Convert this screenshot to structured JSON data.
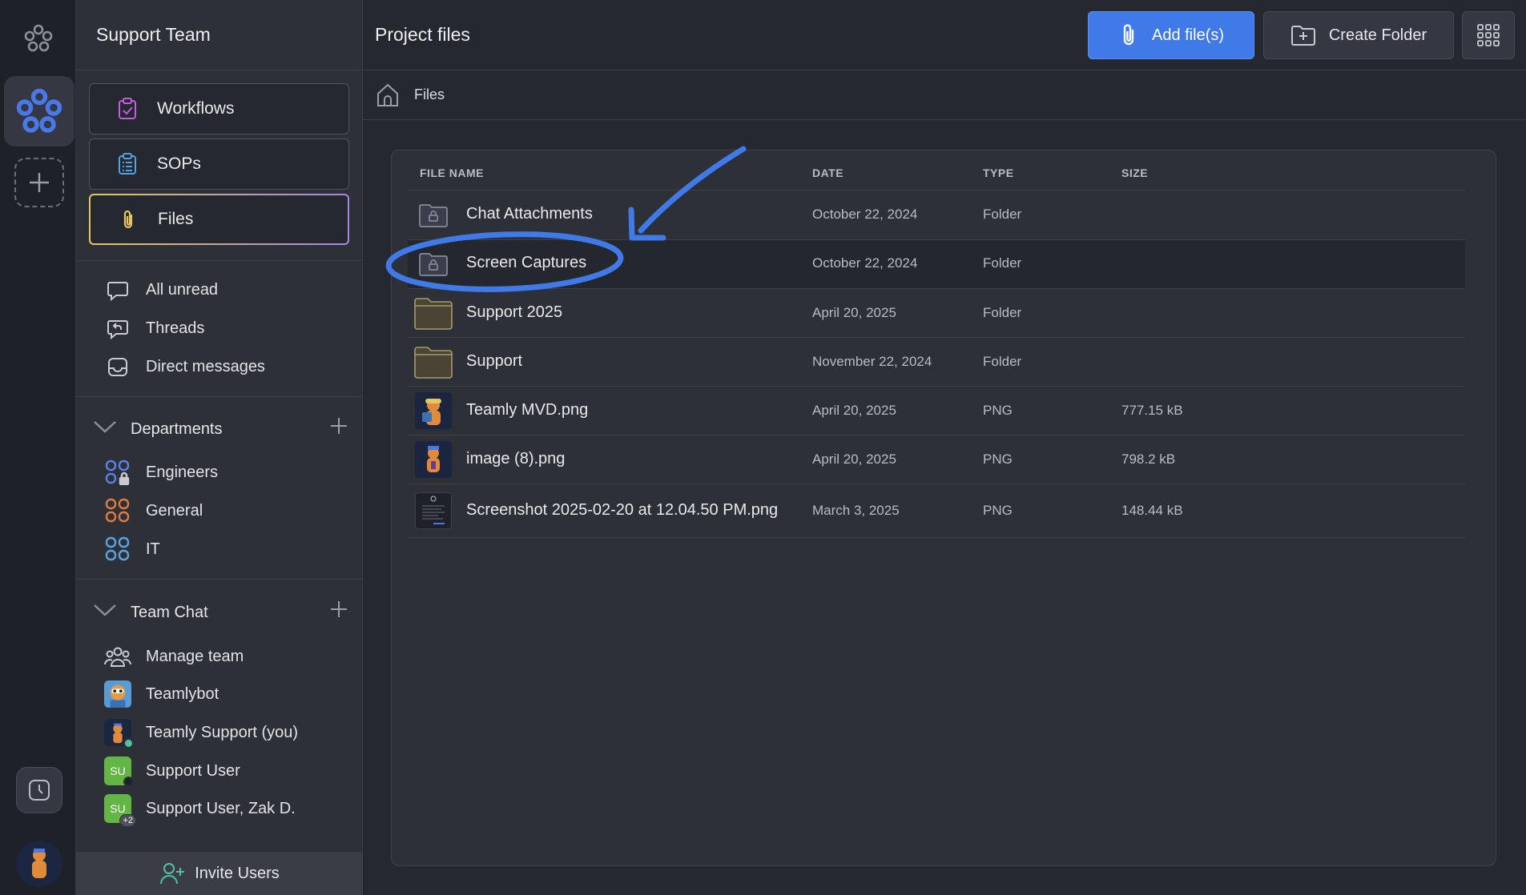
{
  "sidebar": {
    "team_name": "Support Team",
    "nav_buttons": [
      {
        "label": "Workflows",
        "icon": "clipboard-check-icon"
      },
      {
        "label": "SOPs",
        "icon": "clipboard-list-icon"
      },
      {
        "label": "Files",
        "icon": "paperclip-icon"
      }
    ],
    "quick_items": [
      {
        "label": "All unread",
        "icon": "chat-bubble-icon"
      },
      {
        "label": "Threads",
        "icon": "threads-icon"
      },
      {
        "label": "Direct messages",
        "icon": "inbox-icon"
      }
    ],
    "departments": {
      "title": "Departments",
      "items": [
        {
          "label": "Engineers",
          "color": "#5a82e6"
        },
        {
          "label": "General",
          "color": "#e07a42"
        },
        {
          "label": "IT",
          "color": "#5aa4e6"
        }
      ]
    },
    "team_chat": {
      "title": "Team Chat",
      "items": [
        {
          "label": "Manage team"
        },
        {
          "label": "Teamlybot"
        },
        {
          "label": "Teamly Support (you)"
        },
        {
          "label": "Support User",
          "initials": "SU"
        },
        {
          "label": "Support User, Zak D.",
          "initials": "SU",
          "extra": "+2"
        }
      ]
    },
    "invite_label": "Invite Users"
  },
  "header": {
    "title": "Project files",
    "add_files_label": "Add file(s)",
    "create_folder_label": "Create Folder"
  },
  "breadcrumb": {
    "label": "Files"
  },
  "table": {
    "columns": {
      "name": "FILE NAME",
      "date": "DATE",
      "type": "TYPE",
      "size": "SIZE"
    },
    "rows": [
      {
        "name": "Chat Attachments",
        "date": "October 22, 2024",
        "type": "Folder",
        "size": "",
        "kind": "locked-folder"
      },
      {
        "name": "Screen Captures",
        "date": "October 22, 2024",
        "type": "Folder",
        "size": "",
        "kind": "locked-folder"
      },
      {
        "name": "Support 2025",
        "date": "April 20, 2025",
        "type": "Folder",
        "size": "",
        "kind": "folder"
      },
      {
        "name": "Support",
        "date": "November 22, 2024",
        "type": "Folder",
        "size": "",
        "kind": "folder"
      },
      {
        "name": "Teamly MVD.png",
        "date": "April 20, 2025",
        "type": "PNG",
        "size": "777.15 kB",
        "kind": "image"
      },
      {
        "name": "image (8).png",
        "date": "April 20, 2025",
        "type": "PNG",
        "size": "798.2 kB",
        "kind": "image"
      },
      {
        "name": "Screenshot 2025-02-20 at 12.04.50 PM.png",
        "date": "March 3, 2025",
        "type": "PNG",
        "size": "148.44 kB",
        "kind": "screenshot"
      }
    ]
  },
  "colors": {
    "accent": "#3f7ae8",
    "annotation": "#3f7ae8",
    "folder": "#a89a6c"
  }
}
